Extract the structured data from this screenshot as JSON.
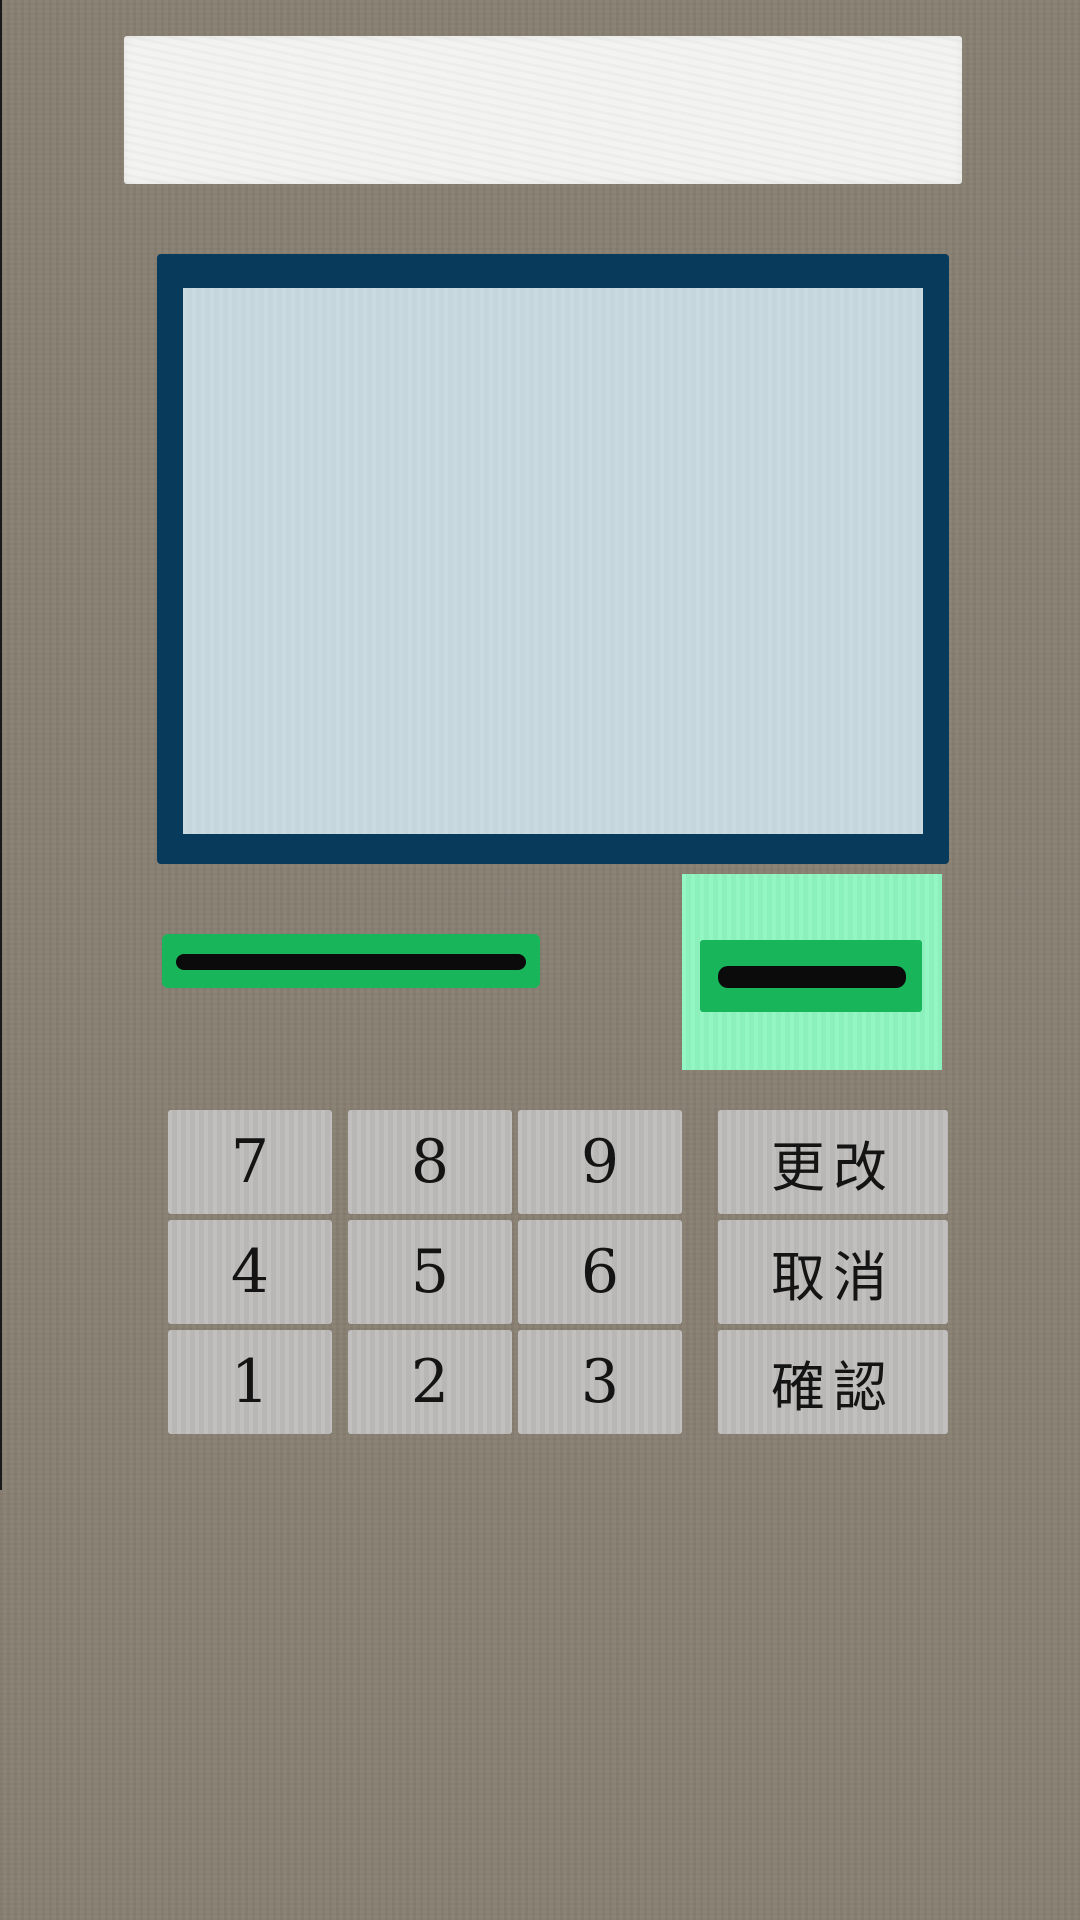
{
  "screen": {
    "message": ""
  },
  "keypad": {
    "numbers": [
      "7",
      "8",
      "9",
      "4",
      "5",
      "6",
      "1",
      "2",
      "3"
    ],
    "functions": {
      "change_label": "更改",
      "cancel_label": "取消",
      "confirm_label": "確認"
    }
  },
  "colors": {
    "body": "#887f72",
    "banner": "#f3f3f1",
    "screen_frame": "#073a5b",
    "screen": "#c8d9e0",
    "slot_green": "#19b55a",
    "cash_panel": "#8ef5bf",
    "key": "#bebdbc"
  }
}
